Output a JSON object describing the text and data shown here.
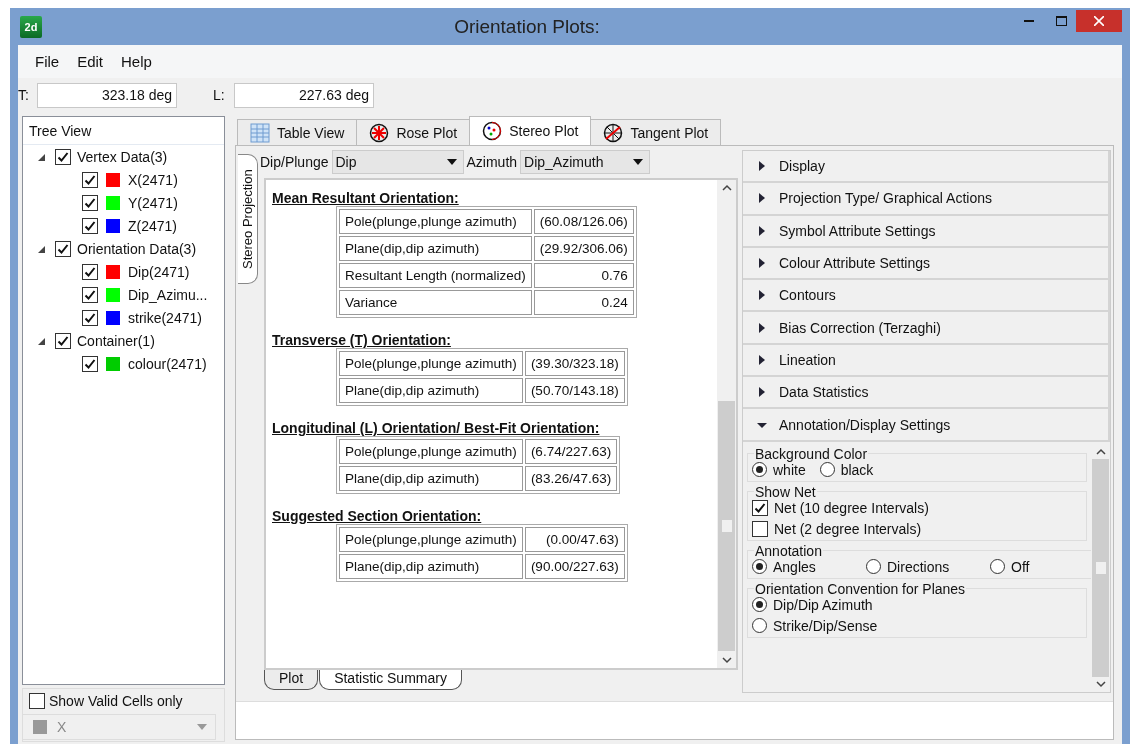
{
  "window": {
    "app_icon": "2d",
    "title": "Orientation Plots:"
  },
  "menu": [
    "File",
    "Edit",
    "Help"
  ],
  "readouts": [
    {
      "label": "T:",
      "value": "323.18 deg"
    },
    {
      "label": "L:",
      "value": "227.63 deg"
    }
  ],
  "tree": {
    "title": "Tree View",
    "items": [
      {
        "label": "Vertex Data(3)",
        "checked": true,
        "expanded": true,
        "children": [
          {
            "label": "X(2471)",
            "checked": true,
            "color": "#ff0000"
          },
          {
            "label": "Y(2471)",
            "checked": true,
            "color": "#00ff00"
          },
          {
            "label": "Z(2471)",
            "checked": true,
            "color": "#0000ff"
          }
        ]
      },
      {
        "label": "Orientation Data(3)",
        "checked": true,
        "expanded": true,
        "children": [
          {
            "label": "Dip(2471)",
            "checked": true,
            "color": "#ff0000"
          },
          {
            "label": "Dip_Azimu...",
            "checked": true,
            "color": "#00ff00"
          },
          {
            "label": "strike(2471)",
            "checked": true,
            "color": "#0000ff"
          }
        ]
      },
      {
        "label": "Container(1)",
        "checked": true,
        "expanded": true,
        "children": [
          {
            "label": "colour(2471)",
            "checked": true,
            "color": "#00cc00"
          }
        ]
      }
    ]
  },
  "valid_filter": {
    "label": "Show Valid Cells only",
    "checked": false
  },
  "column_select": {
    "value": "X",
    "disabled": true
  },
  "tabs": [
    {
      "label": "Table View",
      "selected": false
    },
    {
      "label": "Rose Plot",
      "selected": false
    },
    {
      "label": "Stereo Plot",
      "selected": true
    },
    {
      "label": "Tangent Plot",
      "selected": false
    }
  ],
  "side_tabs": [
    {
      "label": "Stereo Projection",
      "selected": true
    }
  ],
  "selectors": [
    {
      "label": "Dip/Plunge",
      "value": "Dip"
    },
    {
      "label": "Azimuth",
      "value": "Dip_Azimuth"
    }
  ],
  "report": [
    {
      "heading": "Mean Resultant Orientation:",
      "rows": [
        [
          "Pole(plunge,plunge azimuth)",
          "(60.08/126.06)"
        ],
        [
          "Plane(dip,dip azimuth)",
          "(29.92/306.06)"
        ],
        [
          "Resultant Length (normalized)",
          "0.76"
        ],
        [
          "Variance",
          "0.24"
        ]
      ]
    },
    {
      "heading": "Transverse (T) Orientation:",
      "rows": [
        [
          "Pole(plunge,plunge azimuth)",
          "(39.30/323.18)"
        ],
        [
          "Plane(dip,dip azimuth)",
          "(50.70/143.18)"
        ]
      ]
    },
    {
      "heading": "Longitudinal (L) Orientation/ Best-Fit Orientation:",
      "rows": [
        [
          "Pole(plunge,plunge azimuth)",
          "(6.74/227.63)"
        ],
        [
          "Plane(dip,dip azimuth)",
          "(83.26/47.63)"
        ]
      ]
    },
    {
      "heading": "Suggested Section Orientation:",
      "rows": [
        [
          "Pole(plunge,plunge azimuth)",
          "(0.00/47.63)"
        ],
        [
          "Plane(dip,dip azimuth)",
          "(90.00/227.63)"
        ]
      ]
    }
  ],
  "bottom_tabs": [
    {
      "label": "Plot",
      "selected": false
    },
    {
      "label": "Statistic Summary",
      "selected": true
    }
  ],
  "accordion": [
    {
      "label": "Display",
      "expanded": false
    },
    {
      "label": "Projection Type/ Graphical Actions",
      "expanded": false
    },
    {
      "label": "Symbol Attribute Settings",
      "expanded": false
    },
    {
      "label": "Colour Attribute Settings",
      "expanded": false
    },
    {
      "label": "Contours",
      "expanded": false
    },
    {
      "label": "Bias Correction (Terzaghi)",
      "expanded": false
    },
    {
      "label": "Lineation",
      "expanded": false
    },
    {
      "label": "Data Statistics",
      "expanded": false
    },
    {
      "label": "Annotation/Display Settings",
      "expanded": true
    }
  ],
  "settings": [
    {
      "title": "Background Color",
      "inline": true,
      "options": [
        {
          "kind": "radio",
          "label": "white",
          "selected": true
        },
        {
          "kind": "radio",
          "label": "black",
          "selected": false
        }
      ]
    },
    {
      "title": "Show Net",
      "inline": false,
      "options": [
        {
          "kind": "checkbox",
          "label": "Net (10 degree Intervals)",
          "checked": true
        },
        {
          "kind": "checkbox",
          "label": "Net (2 degree Intervals)",
          "checked": false
        }
      ]
    },
    {
      "title": "Annotation",
      "inline": true,
      "options": [
        {
          "kind": "radio",
          "label": "Angles",
          "selected": true
        },
        {
          "kind": "radio",
          "label": "Directions",
          "selected": false
        },
        {
          "kind": "radio",
          "label": "Off",
          "selected": false
        }
      ]
    },
    {
      "title": "Orientation Convention for Planes",
      "inline": false,
      "options": [
        {
          "kind": "radio",
          "label": "Dip/Dip Azimuth",
          "selected": true
        },
        {
          "kind": "radio",
          "label": "Strike/Dip/Sense",
          "selected": false
        }
      ]
    }
  ]
}
